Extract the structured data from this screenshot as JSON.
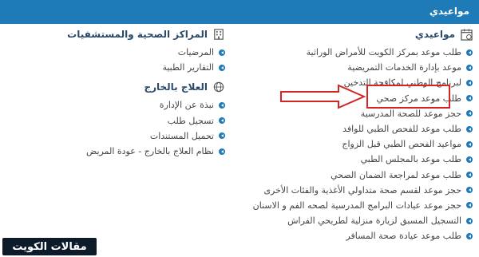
{
  "topbar": {
    "title": "مواعيدي"
  },
  "appointments": {
    "title": "مواعيدي",
    "items": [
      "طلب موعد بمركز الكويت للأمراض الوراثية",
      "موعد بإدارة الخدمات التمريضية",
      "لبرنامج الوطني لمكافحة التدخين",
      "طلب موعد مركز صحي",
      "حجز موعد للصحة المدرسية",
      "طلب موعد للفحص الطبي للوافد",
      "مواعيد الفحص الطبي قبل الزواج",
      "طلب موعد بالمجلس الطبي",
      "طلب موعد لمراجعة الضمان الصحي",
      "حجز موعد لقسم صحة متداولي الأغذية والفئات الأخرى",
      "حجز موعد عيادات البرامج المدرسية لصحه الفم و الاسنان",
      "التسجيل المسبق لزيارة منزلية لطريحي الفراش",
      "طلب موعد عيادة صحة المسافر"
    ]
  },
  "health_centers": {
    "title": "المراكز الصحية والمستشفيات",
    "items": [
      "المرضيات",
      "التقارير الطبية"
    ]
  },
  "abroad": {
    "title": "العلاج بالخارج",
    "items": [
      "نبذة عن الإدارة",
      "تسجيل طلب",
      "تحميل المستندات",
      "نظام العلاج بالخارج - عودة المريض"
    ]
  },
  "logo": {
    "text": "مقالات الكويت"
  },
  "colors": {
    "accent": "#1f7ab8",
    "arrow": "#d42525"
  },
  "icons": {
    "appointments": "calendar-icon",
    "health_centers": "building-icon",
    "abroad": "globe-icon",
    "bullet": "chevron-bullet-icon"
  }
}
